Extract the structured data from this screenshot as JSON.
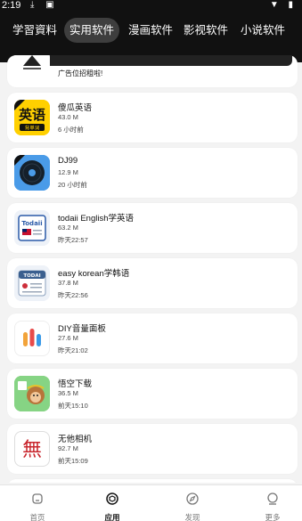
{
  "status_bar": {
    "time": "2:19"
  },
  "tabs": [
    {
      "label": "学習資料",
      "active": false
    },
    {
      "label": "实用软件",
      "active": true
    },
    {
      "label": "漫画软件",
      "active": false
    },
    {
      "label": "影视软件",
      "active": false
    },
    {
      "label": "小说软件",
      "active": false
    }
  ],
  "ad": {
    "text": "广告位招租啦!"
  },
  "apps": [
    {
      "name": "傻瓜英语",
      "size": "43.0 M",
      "time": "6 小时前",
      "icon": "english-book-icon"
    },
    {
      "name": "DJ99",
      "size": "12.9 M",
      "time": "20 小时前",
      "icon": "vinyl-record-icon"
    },
    {
      "name": "todaii English学英语",
      "size": "63.2 M",
      "time": "昨天22:57",
      "icon": "todaii-english-icon"
    },
    {
      "name": "easy korean学韩语",
      "size": "37.8 M",
      "time": "昨天22:56",
      "icon": "todai-korean-icon"
    },
    {
      "name": "DIY音量面板",
      "size": "27.6 M",
      "time": "昨天21:02",
      "icon": "volume-bars-icon"
    },
    {
      "name": "悟空下载",
      "size": "36.5 M",
      "time": "前天15:10",
      "icon": "monkey-icon"
    },
    {
      "name": "无他相机",
      "size": "92.7 M",
      "time": "前天15:09",
      "icon": "wuta-camera-icon"
    }
  ],
  "bottom_nav": [
    {
      "label": "首页",
      "icon": "home-icon",
      "active": false
    },
    {
      "label": "应用",
      "icon": "cube-icon",
      "active": true
    },
    {
      "label": "发现",
      "icon": "compass-icon",
      "active": false
    },
    {
      "label": "更多",
      "icon": "user-icon",
      "active": false
    }
  ],
  "colors": {
    "topbar": "#111111",
    "active_tab": "#3e3e3e",
    "page_bg": "#f3f3f3",
    "card_bg": "#ffffff"
  }
}
